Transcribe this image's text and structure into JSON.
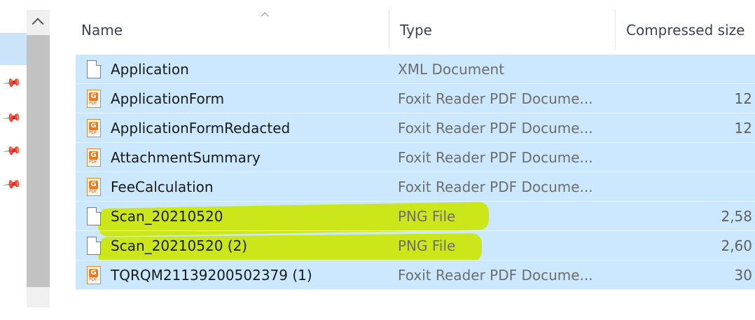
{
  "nav": {
    "pins": [
      "pin-icon",
      "pin-icon",
      "pin-icon",
      "pin-icon"
    ]
  },
  "header": {
    "name": "Name",
    "type": "Type",
    "compressed_size": "Compressed size"
  },
  "files": [
    {
      "name": "Application",
      "type": "XML Document",
      "size": "",
      "icon": "document-icon"
    },
    {
      "name": "ApplicationForm",
      "type": "Foxit Reader PDF Docume...",
      "size": "12",
      "icon": "pdf-icon"
    },
    {
      "name": "ApplicationFormRedacted",
      "type": "Foxit Reader PDF Docume...",
      "size": "12",
      "icon": "pdf-icon"
    },
    {
      "name": "AttachmentSummary",
      "type": "Foxit Reader PDF Docume...",
      "size": "",
      "icon": "pdf-icon"
    },
    {
      "name": "FeeCalculation",
      "type": "Foxit Reader PDF Docume...",
      "size": "",
      "icon": "pdf-icon"
    },
    {
      "name": "Scan_20210520",
      "type": "PNG File",
      "size": "2,58",
      "icon": "document-icon",
      "highlighted": true
    },
    {
      "name": "Scan_20210520 (2)",
      "type": "PNG File",
      "size": "2,60",
      "icon": "document-icon",
      "highlighted": true
    },
    {
      "name": "TQRQM21139200502379 (1)",
      "type": "Foxit Reader PDF Docume...",
      "size": "30",
      "icon": "pdf-icon"
    }
  ],
  "colors": {
    "selection": "#cce8ff",
    "highlighter": "#cbe700"
  }
}
